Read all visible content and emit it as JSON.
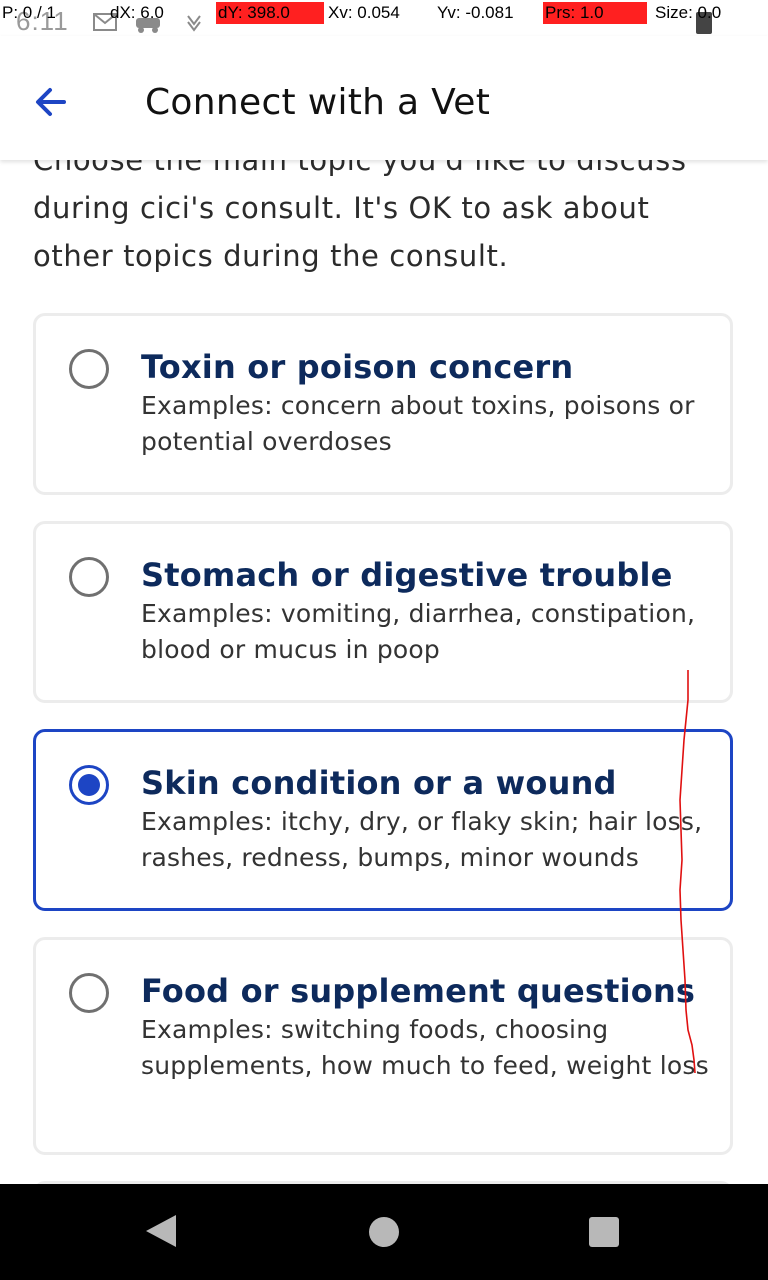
{
  "status_bar": {
    "time": "6:11",
    "overlay": {
      "pointer": "P: 0 / 1",
      "dx": "dX: 6.0",
      "dy": "dY: 398.0",
      "xv": "Xv: 0.054",
      "yv": "Yv: -0.081",
      "prs": "Prs: 1.0",
      "size": "Size: 0.0"
    }
  },
  "app_bar": {
    "title": "Connect with a Vet",
    "back_icon": "arrow-left-icon"
  },
  "intro_text": "Choose the main topic you'd like to discuss during cici's consult. It's OK to ask about other topics during the consult.",
  "topics": [
    {
      "title": "Toxin or poison concern",
      "description": "Examples: concern about toxins, poisons or potential overdoses",
      "selected": false
    },
    {
      "title": "Stomach or digestive trouble",
      "description": "Examples: vomiting, diarrhea, constipation, blood or mucus in poop",
      "selected": false
    },
    {
      "title": "Skin condition or a wound",
      "description": "Examples: itchy, dry, or flaky skin; hair loss, rashes, redness, bumps, minor wounds",
      "selected": true
    },
    {
      "title": "Food or supplement questions",
      "description": "Examples: switching foods, choosing supplements, how much to feed, weight loss",
      "selected": false
    }
  ],
  "colors": {
    "accent": "#1d45c4",
    "title_text": "#0d2a5c",
    "card_border": "#ececec",
    "overlay_highlight": "#ff2020"
  },
  "nav_bar": {
    "back_icon": "triangle-back-icon",
    "home_icon": "circle-home-icon",
    "recents_icon": "square-recents-icon"
  }
}
